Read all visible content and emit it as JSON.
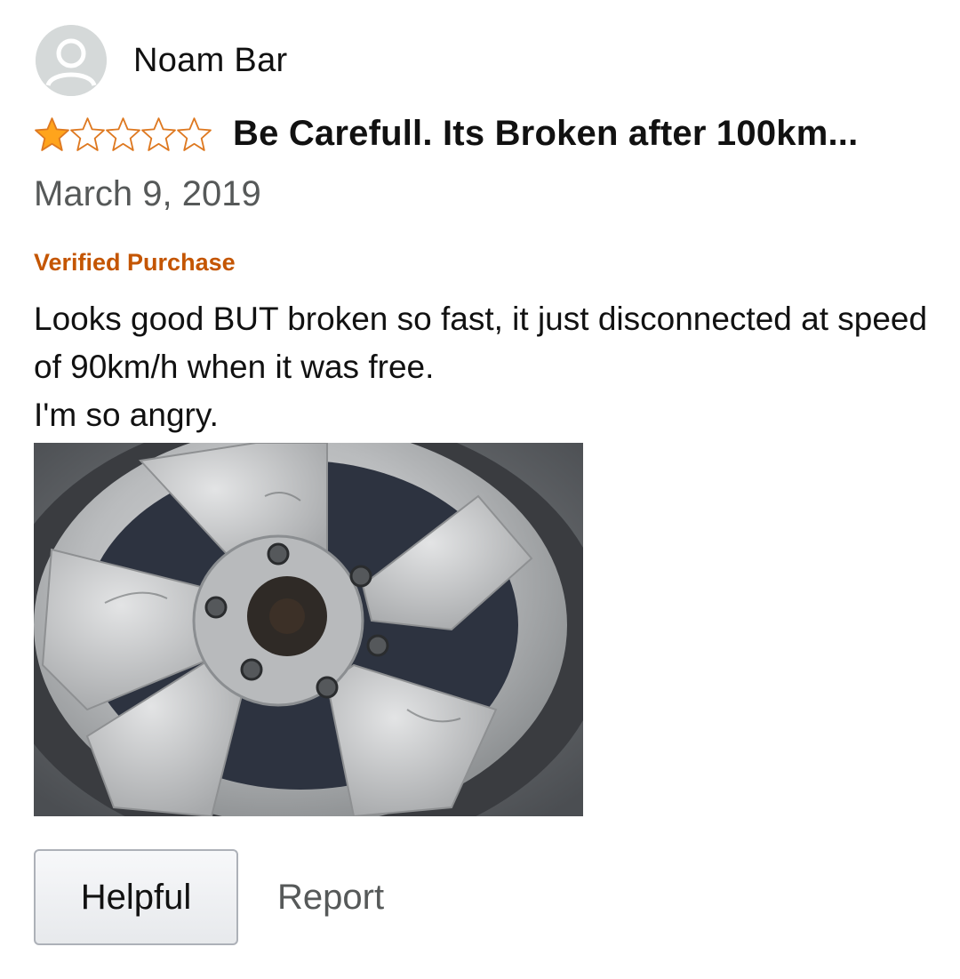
{
  "review": {
    "author": "Noam Bar",
    "rating": 1,
    "max_rating": 5,
    "title": "Be Carefull. Its Broken after 100km...",
    "date": "March 9, 2019",
    "verified": "Verified Purchase",
    "body_lines": [
      "Looks good BUT broken so fast, it just disconnected at speed of 90km/h when it was free.",
      "I'm so angry."
    ]
  },
  "actions": {
    "helpful_label": "Helpful",
    "report_label": "Report"
  },
  "icons": {
    "avatar": "user-silhouette-icon",
    "star_filled": "star-filled-icon",
    "star_empty": "star-empty-icon"
  },
  "colors": {
    "star": "#ffa41c",
    "star_outline": "#de7921",
    "verified": "#c45500",
    "muted_text": "#565959"
  }
}
